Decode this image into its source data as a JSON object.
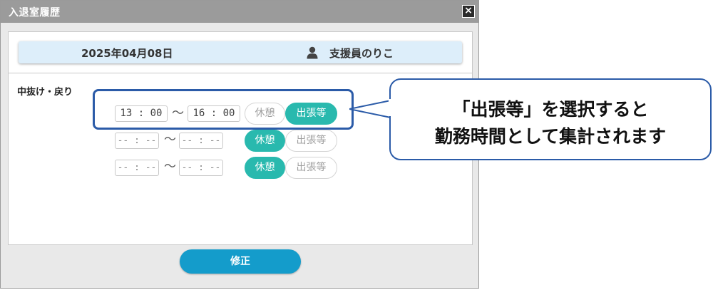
{
  "dialog": {
    "title": "入退室履歴",
    "close_label": "×"
  },
  "header": {
    "date": "2025年04月08日",
    "user_icon": "person-icon",
    "user_name": "支援員のりこ"
  },
  "section": {
    "label": "中抜け・戻り"
  },
  "rows": [
    {
      "start": "13 : 00",
      "separator": "〜",
      "end": "16 : 00",
      "break_label": "休憩",
      "trip_label": "出張等",
      "selected": "trip"
    },
    {
      "start": "-- : --",
      "separator": "〜",
      "end": "-- : --",
      "break_label": "休憩",
      "trip_label": "出張等",
      "selected": "break"
    },
    {
      "start": "-- : --",
      "separator": "〜",
      "end": "-- : --",
      "break_label": "休憩",
      "trip_label": "出張等",
      "selected": "break"
    }
  ],
  "footer": {
    "save_label": "修正"
  },
  "callout": {
    "line1": "「出張等」を選択すると",
    "line2": "勤務時間として集計されます"
  },
  "colors": {
    "titlebar": "#9b9b9b",
    "header_bg": "#ddeefa",
    "pill_active": "#29b9ae",
    "save_button": "#149ccb",
    "annotation": "#2b5ba8"
  }
}
